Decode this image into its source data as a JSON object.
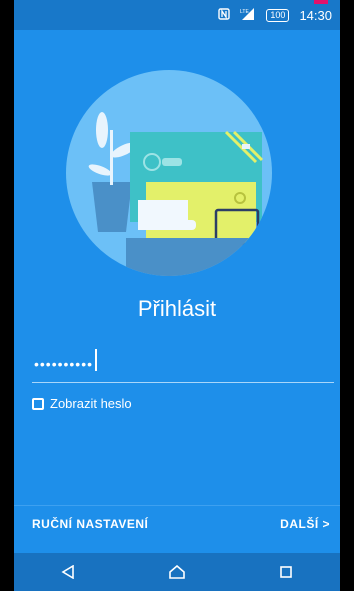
{
  "statusbar": {
    "time": "14:30",
    "battery": "100",
    "icons": [
      "nfc-icon",
      "signal-icon",
      "battery-icon"
    ],
    "network_label": "LTE"
  },
  "illustration": {
    "name": "setup-illustration"
  },
  "title": "Přihlásit",
  "password": {
    "value": "••••••••••",
    "show_label": "Zobrazit heslo",
    "show_checked": false
  },
  "actions": {
    "manual_label": "RUČNÍ NASTAVENÍ",
    "next_label": "DALŠÍ >"
  },
  "navbar": {
    "icons": [
      "back-icon",
      "home-icon",
      "recents-icon"
    ]
  },
  "colors": {
    "background": "#1E8FEA",
    "statusbar": "#1878C9",
    "navbar": "#1872C0",
    "circle": "#6CC0F7",
    "accent_pink": "#E0136C"
  }
}
